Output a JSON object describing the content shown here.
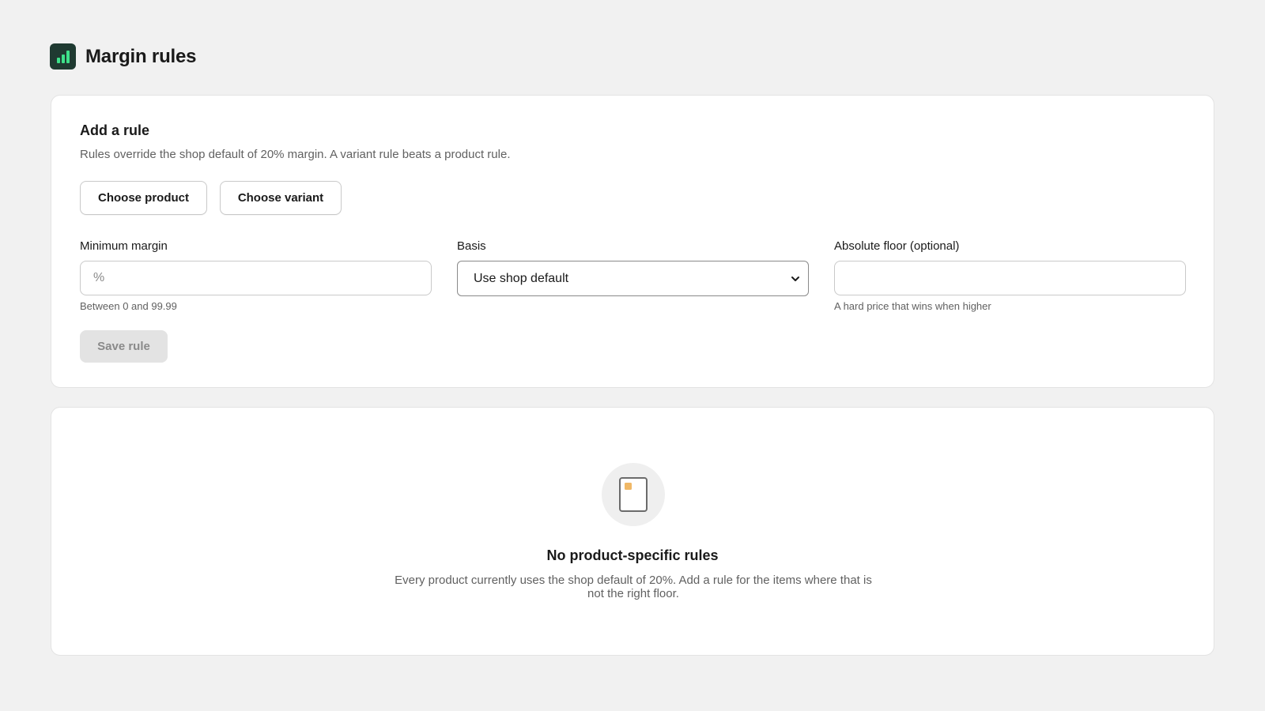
{
  "header": {
    "title": "Margin rules",
    "icon": "bar-chart-icon",
    "icon_bg": "#1f3a31",
    "icon_fg": "#3ee08a"
  },
  "add_rule": {
    "title": "Add a rule",
    "description": "Rules override the shop default of 20% margin. A variant rule beats a product rule.",
    "choose_product_label": "Choose product",
    "choose_variant_label": "Choose variant",
    "minimum_margin": {
      "label": "Minimum margin",
      "placeholder": "%",
      "value": "",
      "help": "Between 0 and 99.99"
    },
    "basis": {
      "label": "Basis",
      "selected": "Use shop default"
    },
    "absolute_floor": {
      "label": "Absolute floor (optional)",
      "value": "",
      "placeholder": "",
      "help": "A hard price that wins when higher"
    },
    "save_label": "Save rule"
  },
  "empty_state": {
    "icon": "document-icon",
    "title": "No product-specific rules",
    "description": "Every product currently uses the shop default of 20%. Add a rule for the items where that is not the right floor."
  },
  "colors": {
    "page_bg": "#f1f1f1",
    "card_bg": "#ffffff",
    "accent": "#3ee08a",
    "disabled_bg": "#e3e3e3",
    "muted_text": "#616161"
  }
}
